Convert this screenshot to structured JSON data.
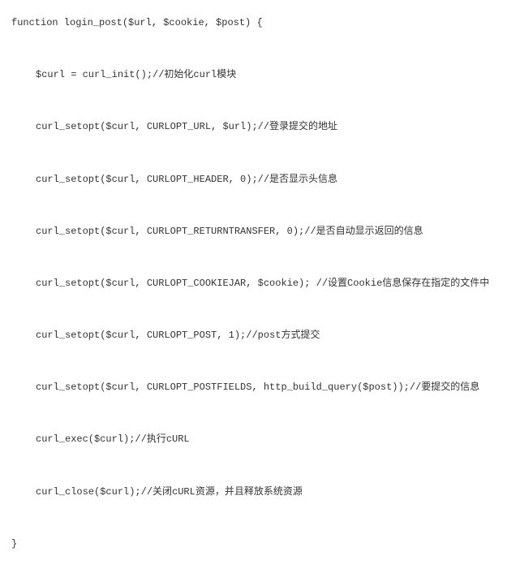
{
  "code": {
    "lines": [
      {
        "indent": 0,
        "text": "function login_post($url, $cookie, $post) {"
      },
      {
        "indent": 1,
        "text": "$curl = curl_init();//初始化curl模块"
      },
      {
        "indent": 1,
        "text": "curl_setopt($curl, CURLOPT_URL, $url);//登录提交的地址"
      },
      {
        "indent": 1,
        "text": "curl_setopt($curl, CURLOPT_HEADER, 0);//是否显示头信息"
      },
      {
        "indent": 1,
        "text": "curl_setopt($curl, CURLOPT_RETURNTRANSFER, 0);//是否自动显示返回的信息"
      },
      {
        "indent": 1,
        "text": "curl_setopt($curl, CURLOPT_COOKIEJAR, $cookie); //设置Cookie信息保存在指定的文件中"
      },
      {
        "indent": 1,
        "text": "curl_setopt($curl, CURLOPT_POST, 1);//post方式提交"
      },
      {
        "indent": 1,
        "text": "curl_setopt($curl, CURLOPT_POSTFIELDS, http_build_query($post));//要提交的信息"
      },
      {
        "indent": 1,
        "text": "curl_exec($curl);//执行cURL"
      },
      {
        "indent": 1,
        "text": "curl_close($curl);//关闭cURL资源，并且释放系统资源"
      },
      {
        "indent": 0,
        "text": "}"
      }
    ]
  }
}
